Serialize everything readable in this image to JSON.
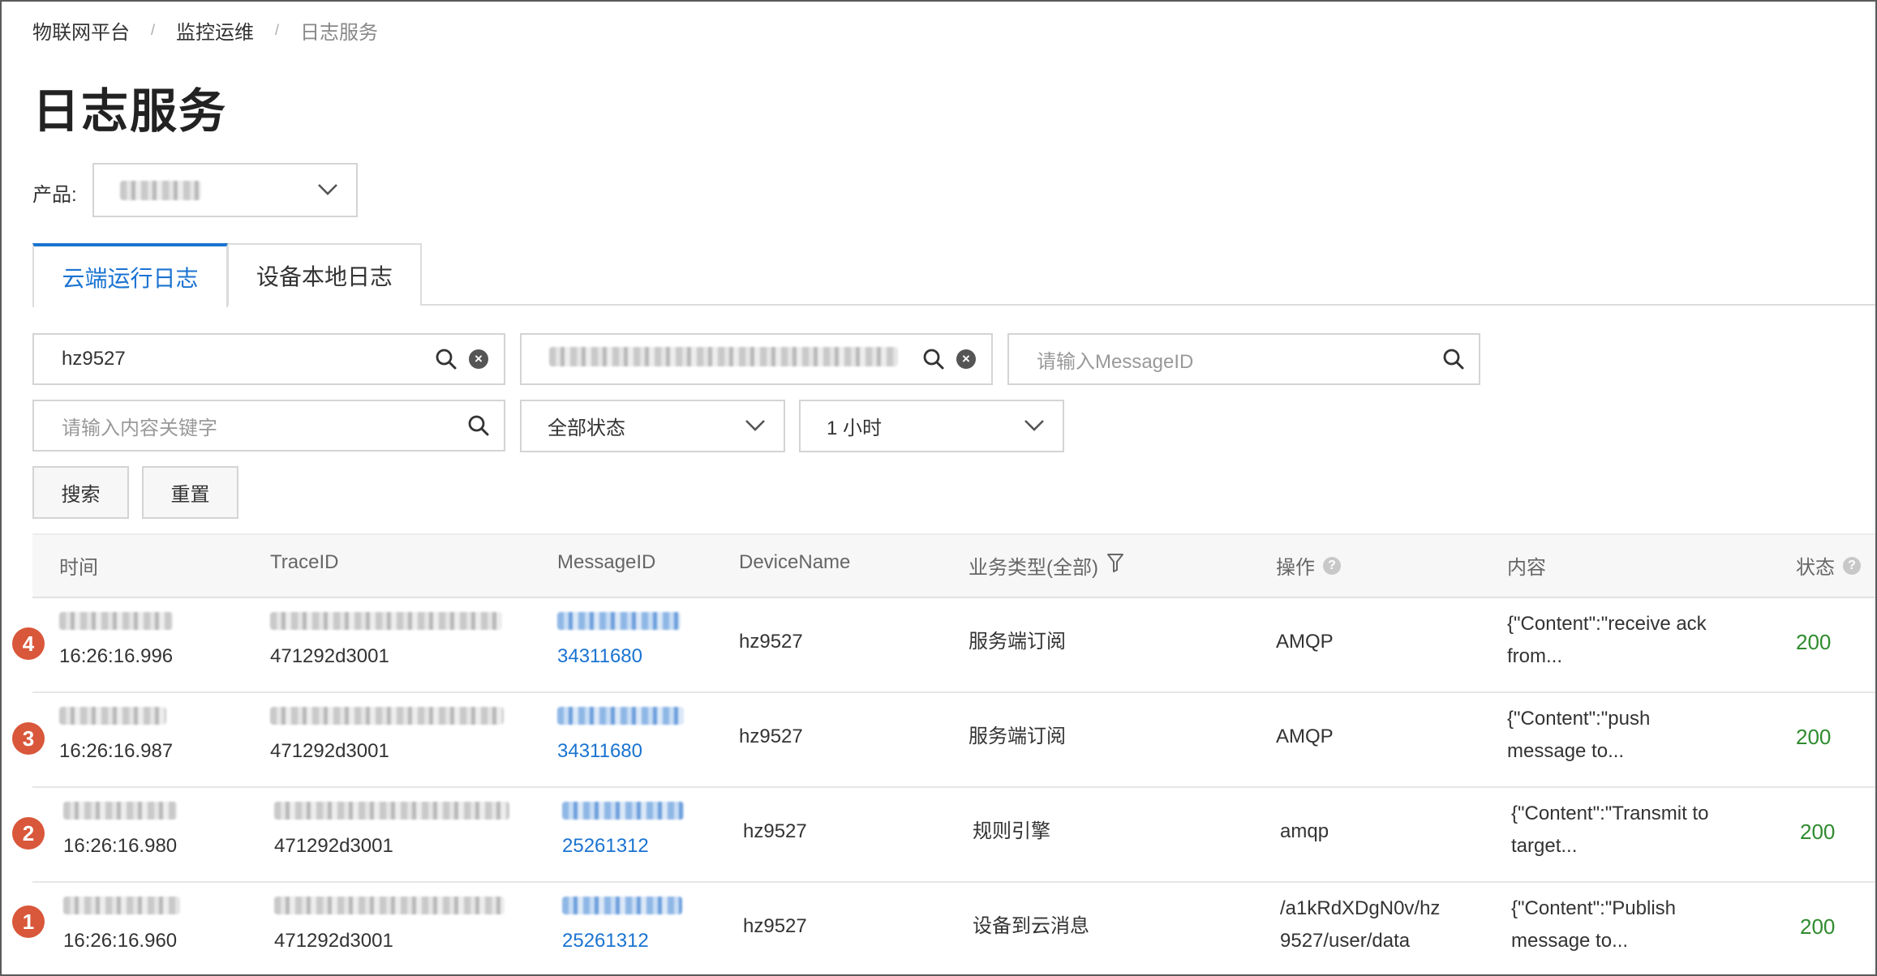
{
  "breadcrumb": [
    "物联网平台",
    "监控运维",
    "日志服务"
  ],
  "page_title": "日志服务",
  "product": {
    "label": "产品:",
    "value_blurred": true
  },
  "tabs": [
    "云端运行日志",
    "设备本地日志"
  ],
  "filters": {
    "device_name": "hz9527",
    "trace_id_blurred": true,
    "message_id_placeholder": "请输入MessageID",
    "keyword_placeholder": "请输入内容关键字",
    "status": "全部状态",
    "time_range": "1 小时"
  },
  "buttons": {
    "search": "搜索",
    "reset": "重置"
  },
  "columns": [
    "时间",
    "TraceID",
    "MessageID",
    "DeviceName",
    "业务类型(全部)",
    "操作",
    "内容",
    "状态"
  ],
  "rows": [
    {
      "marker": "4",
      "time": "16:26:16.996",
      "trace_id_tail": "471292d3001",
      "message_id_tail": "34311680",
      "device": "hz9527",
      "biz_type": "服务端订阅",
      "operation": "AMQP",
      "content": [
        "{\"Content\":\"receive ack",
        "from..."
      ],
      "status": "200"
    },
    {
      "marker": "3",
      "time": "16:26:16.987",
      "trace_id_tail": "471292d3001",
      "message_id_tail": "34311680",
      "device": "hz9527",
      "biz_type": "服务端订阅",
      "operation": "AMQP",
      "content": [
        "{\"Content\":\"push",
        "message to..."
      ],
      "status": "200"
    },
    {
      "marker": "2",
      "time": "16:26:16.980",
      "trace_id_tail": "471292d3001",
      "message_id_tail": "25261312",
      "device": "hz9527",
      "biz_type": "规则引擎",
      "operation": "amqp",
      "content": [
        "{\"Content\":\"Transmit to",
        "target..."
      ],
      "status": "200"
    },
    {
      "marker": "1",
      "time": "16:26:16.960",
      "trace_id_tail": "471292d3001",
      "message_id_tail": "25261312",
      "device": "hz9527",
      "biz_type": "设备到云消息",
      "operation": [
        "/a1kRdXDgN0v/hz",
        "9527/user/data"
      ],
      "content": [
        "{\"Content\":\"Publish",
        "message to..."
      ],
      "status": "200"
    }
  ],
  "colors": {
    "accent": "#1a73d1",
    "status_ok": "#2e8b2e",
    "marker": "#d9573a"
  }
}
